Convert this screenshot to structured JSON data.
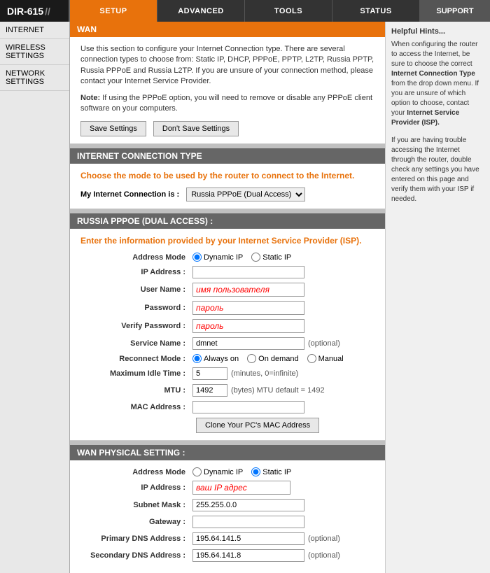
{
  "header": {
    "logo": "DIR-615",
    "tabs": [
      {
        "label": "SETUP",
        "active": true
      },
      {
        "label": "ADVANCED",
        "active": false
      },
      {
        "label": "TOOLS",
        "active": false
      },
      {
        "label": "STATUS",
        "active": false
      }
    ],
    "support": "SUPPORT"
  },
  "sidebar": {
    "items": [
      {
        "label": "INTERNET"
      },
      {
        "label": "WIRELESS SETTINGS"
      },
      {
        "label": "NETWORK SETTINGS"
      }
    ]
  },
  "wan": {
    "title": "WAN",
    "desc": "Use this section to configure your Internet Connection type. There are several connection types to choose from: Static IP, DHCP, PPPoE, PPTP, L2TP, Russia PPTP, Russia PPPoE and Russia L2TP. If you are unsure of your connection method, please contact your Internet Service Provider.",
    "note_prefix": "Note:",
    "note": " If using the PPPoE option, you will need to remove or disable any PPPoE client software on your computers.",
    "save_btn": "Save Settings",
    "dont_save_btn": "Don't Save Settings"
  },
  "connection_type": {
    "section_label": "INTERNET CONNECTION TYPE",
    "title": "Choose the mode to be used by the router to connect to the Internet.",
    "label": "My Internet Connection is :",
    "selected": "Russia PPPoE (Dual Access)",
    "options": [
      "Russia PPPoE (Dual Access)"
    ]
  },
  "pppoe": {
    "section_label": "RUSSIA PPPOE (DUAL ACCESS) :",
    "title": "Enter the information provided by your Internet Service Provider (ISP).",
    "fields": [
      {
        "label": "Address Mode",
        "type": "radio",
        "options": [
          "Dynamic IP",
          "Static IP"
        ],
        "selected": 0
      },
      {
        "label": "IP Address :",
        "type": "input",
        "value": "",
        "placeholder": ""
      },
      {
        "label": "User Name :",
        "type": "input-red",
        "value": "имя пользователя",
        "placeholder": ""
      },
      {
        "label": "Password :",
        "type": "input-red",
        "value": "пароль",
        "placeholder": ""
      },
      {
        "label": "Verify Password :",
        "type": "input-red",
        "value": "пароль",
        "placeholder": ""
      },
      {
        "label": "Service Name :",
        "type": "input",
        "value": "dmnet",
        "hint": "(optional)"
      },
      {
        "label": "Reconnect Mode :",
        "type": "radio3",
        "options": [
          "Always on",
          "On demand",
          "Manual"
        ],
        "selected": 0
      },
      {
        "label": "Maximum Idle Time :",
        "type": "input-hint",
        "value": "5",
        "hint": "(minutes, 0=infinite)"
      },
      {
        "label": "MTU :",
        "type": "input-hint",
        "value": "1492",
        "hint": "(bytes) MTU default = 1492"
      },
      {
        "label": "MAC Address :",
        "type": "input",
        "value": "",
        "placeholder": ""
      }
    ],
    "clone_btn": "Clone Your PC's MAC Address"
  },
  "wan_physical": {
    "section_label": "WAN PHYSICAL SETTING :",
    "fields": [
      {
        "label": "Address Mode",
        "type": "radio",
        "options": [
          "Dynamic IP",
          "Static IP"
        ],
        "selected": 1
      },
      {
        "label": "IP Address :",
        "type": "input-red",
        "value": "ваш IP адрес",
        "placeholder": ""
      },
      {
        "label": "Subnet Mask :",
        "type": "input",
        "value": "255.255.0.0",
        "placeholder": ""
      },
      {
        "label": "Gateway :",
        "type": "input",
        "value": "",
        "placeholder": ""
      },
      {
        "label": "Primary DNS Address :",
        "type": "input-hint",
        "value": "195.64.141.5",
        "hint": "(optional)"
      },
      {
        "label": "Secondary DNS Address :",
        "type": "input-hint",
        "value": "195.64.141.8",
        "hint": "(optional)"
      }
    ]
  },
  "help": {
    "title": "Helpful Hints...",
    "text1": "When configuring the router to access the Internet, be sure to choose the correct ",
    "text1b": "Internet Connection Type",
    "text1c": " from the drop down menu. If you are unsure of which option to choose, contact your ",
    "text1d": "Internet Service Provider (ISP).",
    "text2": "If you are having trouble accessing the Internet through the router, double check any settings you have entered on this page and verify them with your ISP if needed."
  }
}
